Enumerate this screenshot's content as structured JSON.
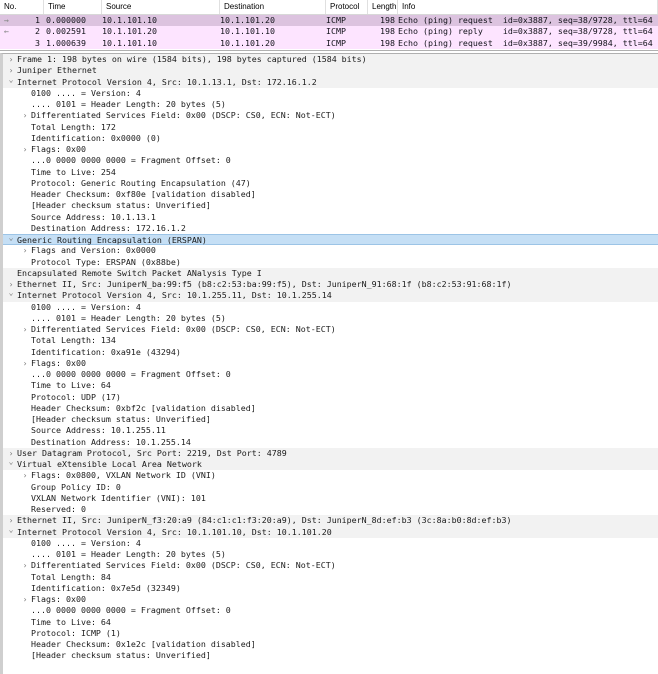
{
  "packet_list": {
    "columns": [
      "No.",
      "Time",
      "Source",
      "Destination",
      "Protocol",
      "Length",
      "Info"
    ],
    "colors": {
      "row_selected": "#dcc3df",
      "row_icmp": "#fde4ff"
    },
    "rows": [
      {
        "marker": "→",
        "no": "1",
        "time": "0.000000",
        "source": "10.1.101.10",
        "destination": "10.1.101.20",
        "protocol": "ICMP",
        "length": "198",
        "info": "Echo (ping) request  id=0x3887, seq=38/9728, ttl=64"
      },
      {
        "marker": "←",
        "no": "2",
        "time": "0.002591",
        "source": "10.1.101.20",
        "destination": "10.1.101.10",
        "protocol": "ICMP",
        "length": "198",
        "info": "Echo (ping) reply    id=0x3887, seq=38/9728, ttl=64"
      },
      {
        "marker": "",
        "no": "3",
        "time": "1.000639",
        "source": "10.1.101.10",
        "destination": "10.1.101.20",
        "protocol": "ICMP",
        "length": "198",
        "info": "Echo (ping) request  id=0x3887, seq=39/9984, ttl=64"
      }
    ]
  },
  "details": [
    {
      "t": "Frame 1: 198 bytes on wire (1584 bits), 198 bytes captured (1584 bits)",
      "l": 0,
      "a": "c"
    },
    {
      "t": "Juniper Ethernet",
      "l": 0,
      "a": "c"
    },
    {
      "t": "Internet Protocol Version 4, Src: 10.1.13.1, Dst: 172.16.1.2",
      "l": 0,
      "a": "e"
    },
    {
      "t": "0100 .... = Version: 4",
      "l": 1,
      "a": ""
    },
    {
      "t": ".... 0101 = Header Length: 20 bytes (5)",
      "l": 1,
      "a": ""
    },
    {
      "t": "Differentiated Services Field: 0x00 (DSCP: CS0, ECN: Not-ECT)",
      "l": 1,
      "a": "c"
    },
    {
      "t": "Total Length: 172",
      "l": 1,
      "a": ""
    },
    {
      "t": "Identification: 0x0000 (0)",
      "l": 1,
      "a": ""
    },
    {
      "t": "Flags: 0x00",
      "l": 1,
      "a": "c"
    },
    {
      "t": "...0 0000 0000 0000 = Fragment Offset: 0",
      "l": 1,
      "a": ""
    },
    {
      "t": "Time to Live: 254",
      "l": 1,
      "a": ""
    },
    {
      "t": "Protocol: Generic Routing Encapsulation (47)",
      "l": 1,
      "a": ""
    },
    {
      "t": "Header Checksum: 0xf80e [validation disabled]",
      "l": 1,
      "a": ""
    },
    {
      "t": "[Header checksum status: Unverified]",
      "l": 1,
      "a": ""
    },
    {
      "t": "Source Address: 10.1.13.1",
      "l": 1,
      "a": ""
    },
    {
      "t": "Destination Address: 172.16.1.2",
      "l": 1,
      "a": ""
    },
    {
      "t": "Generic Routing Encapsulation (ERSPAN)",
      "l": 0,
      "a": "e",
      "sel": true
    },
    {
      "t": "Flags and Version: 0x0000",
      "l": 1,
      "a": "c"
    },
    {
      "t": "Protocol Type: ERSPAN (0x88be)",
      "l": 1,
      "a": ""
    },
    {
      "t": "Encapsulated Remote Switch Packet ANalysis Type I",
      "l": 0,
      "a": ""
    },
    {
      "t": "Ethernet II, Src: JuniperN_ba:99:f5 (b8:c2:53:ba:99:f5), Dst: JuniperN_91:68:1f (b8:c2:53:91:68:1f)",
      "l": 0,
      "a": "c"
    },
    {
      "t": "Internet Protocol Version 4, Src: 10.1.255.11, Dst: 10.1.255.14",
      "l": 0,
      "a": "e"
    },
    {
      "t": "0100 .... = Version: 4",
      "l": 1,
      "a": ""
    },
    {
      "t": ".... 0101 = Header Length: 20 bytes (5)",
      "l": 1,
      "a": ""
    },
    {
      "t": "Differentiated Services Field: 0x00 (DSCP: CS0, ECN: Not-ECT)",
      "l": 1,
      "a": "c"
    },
    {
      "t": "Total Length: 134",
      "l": 1,
      "a": ""
    },
    {
      "t": "Identification: 0xa91e (43294)",
      "l": 1,
      "a": ""
    },
    {
      "t": "Flags: 0x00",
      "l": 1,
      "a": "c"
    },
    {
      "t": "...0 0000 0000 0000 = Fragment Offset: 0",
      "l": 1,
      "a": ""
    },
    {
      "t": "Time to Live: 64",
      "l": 1,
      "a": ""
    },
    {
      "t": "Protocol: UDP (17)",
      "l": 1,
      "a": ""
    },
    {
      "t": "Header Checksum: 0xbf2c [validation disabled]",
      "l": 1,
      "a": ""
    },
    {
      "t": "[Header checksum status: Unverified]",
      "l": 1,
      "a": ""
    },
    {
      "t": "Source Address: 10.1.255.11",
      "l": 1,
      "a": ""
    },
    {
      "t": "Destination Address: 10.1.255.14",
      "l": 1,
      "a": ""
    },
    {
      "t": "User Datagram Protocol, Src Port: 2219, Dst Port: 4789",
      "l": 0,
      "a": "c"
    },
    {
      "t": "Virtual eXtensible Local Area Network",
      "l": 0,
      "a": "e"
    },
    {
      "t": "Flags: 0x0800, VXLAN Network ID (VNI)",
      "l": 1,
      "a": "c"
    },
    {
      "t": "Group Policy ID: 0",
      "l": 1,
      "a": ""
    },
    {
      "t": "VXLAN Network Identifier (VNI): 101",
      "l": 1,
      "a": ""
    },
    {
      "t": "Reserved: 0",
      "l": 1,
      "a": ""
    },
    {
      "t": "Ethernet II, Src: JuniperN_f3:20:a9 (84:c1:c1:f3:20:a9), Dst: JuniperN_8d:ef:b3 (3c:8a:b0:8d:ef:b3)",
      "l": 0,
      "a": "c"
    },
    {
      "t": "Internet Protocol Version 4, Src: 10.1.101.10, Dst: 10.1.101.20",
      "l": 0,
      "a": "e"
    },
    {
      "t": "0100 .... = Version: 4",
      "l": 1,
      "a": ""
    },
    {
      "t": ".... 0101 = Header Length: 20 bytes (5)",
      "l": 1,
      "a": ""
    },
    {
      "t": "Differentiated Services Field: 0x00 (DSCP: CS0, ECN: Not-ECT)",
      "l": 1,
      "a": "c"
    },
    {
      "t": "Total Length: 84",
      "l": 1,
      "a": ""
    },
    {
      "t": "Identification: 0x7e5d (32349)",
      "l": 1,
      "a": ""
    },
    {
      "t": "Flags: 0x00",
      "l": 1,
      "a": "c"
    },
    {
      "t": "...0 0000 0000 0000 = Fragment Offset: 0",
      "l": 1,
      "a": ""
    },
    {
      "t": "Time to Live: 64",
      "l": 1,
      "a": ""
    },
    {
      "t": "Protocol: ICMP (1)",
      "l": 1,
      "a": ""
    },
    {
      "t": "Header Checksum: 0x1e2c [validation disabled]",
      "l": 1,
      "a": ""
    },
    {
      "t": "[Header checksum status: Unverified]",
      "l": 1,
      "a": ""
    }
  ]
}
